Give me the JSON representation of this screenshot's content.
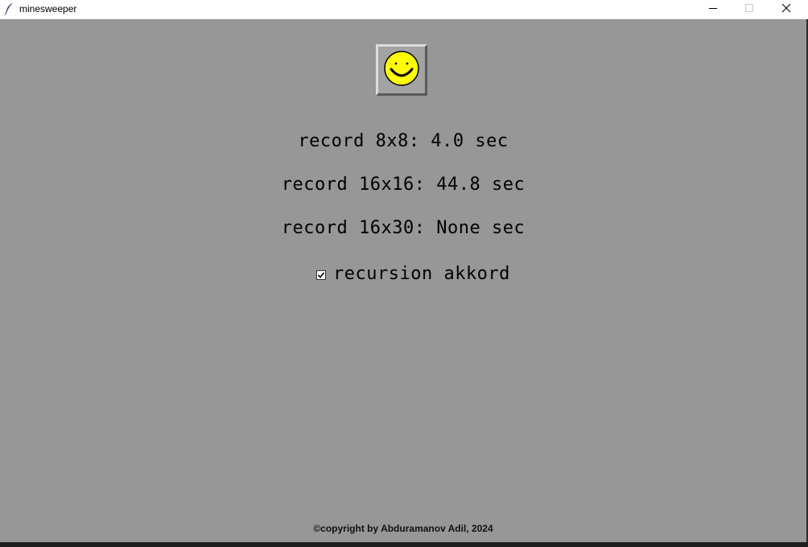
{
  "window": {
    "title": "minesweeper",
    "app_icon": "feather-icon",
    "controls": {
      "minimize_icon": "minimize-icon",
      "maximize_icon": "maximize-icon",
      "close_icon": "close-icon"
    }
  },
  "game": {
    "smiley_icon": "smiley-face-icon",
    "records": [
      "record 8x8: 4.0 sec",
      "record 16x16: 44.8 sec",
      "record 16x30: None sec"
    ],
    "recursion_option": {
      "label": "recursion akkord",
      "checked": true
    }
  },
  "footer": {
    "copyright": "©copyright by Abduramanov Adil, 2024"
  },
  "colors": {
    "background": "#979797",
    "button_face": "#a3a3a3",
    "smiley_fill": "#ffff00",
    "text": "#000000"
  }
}
